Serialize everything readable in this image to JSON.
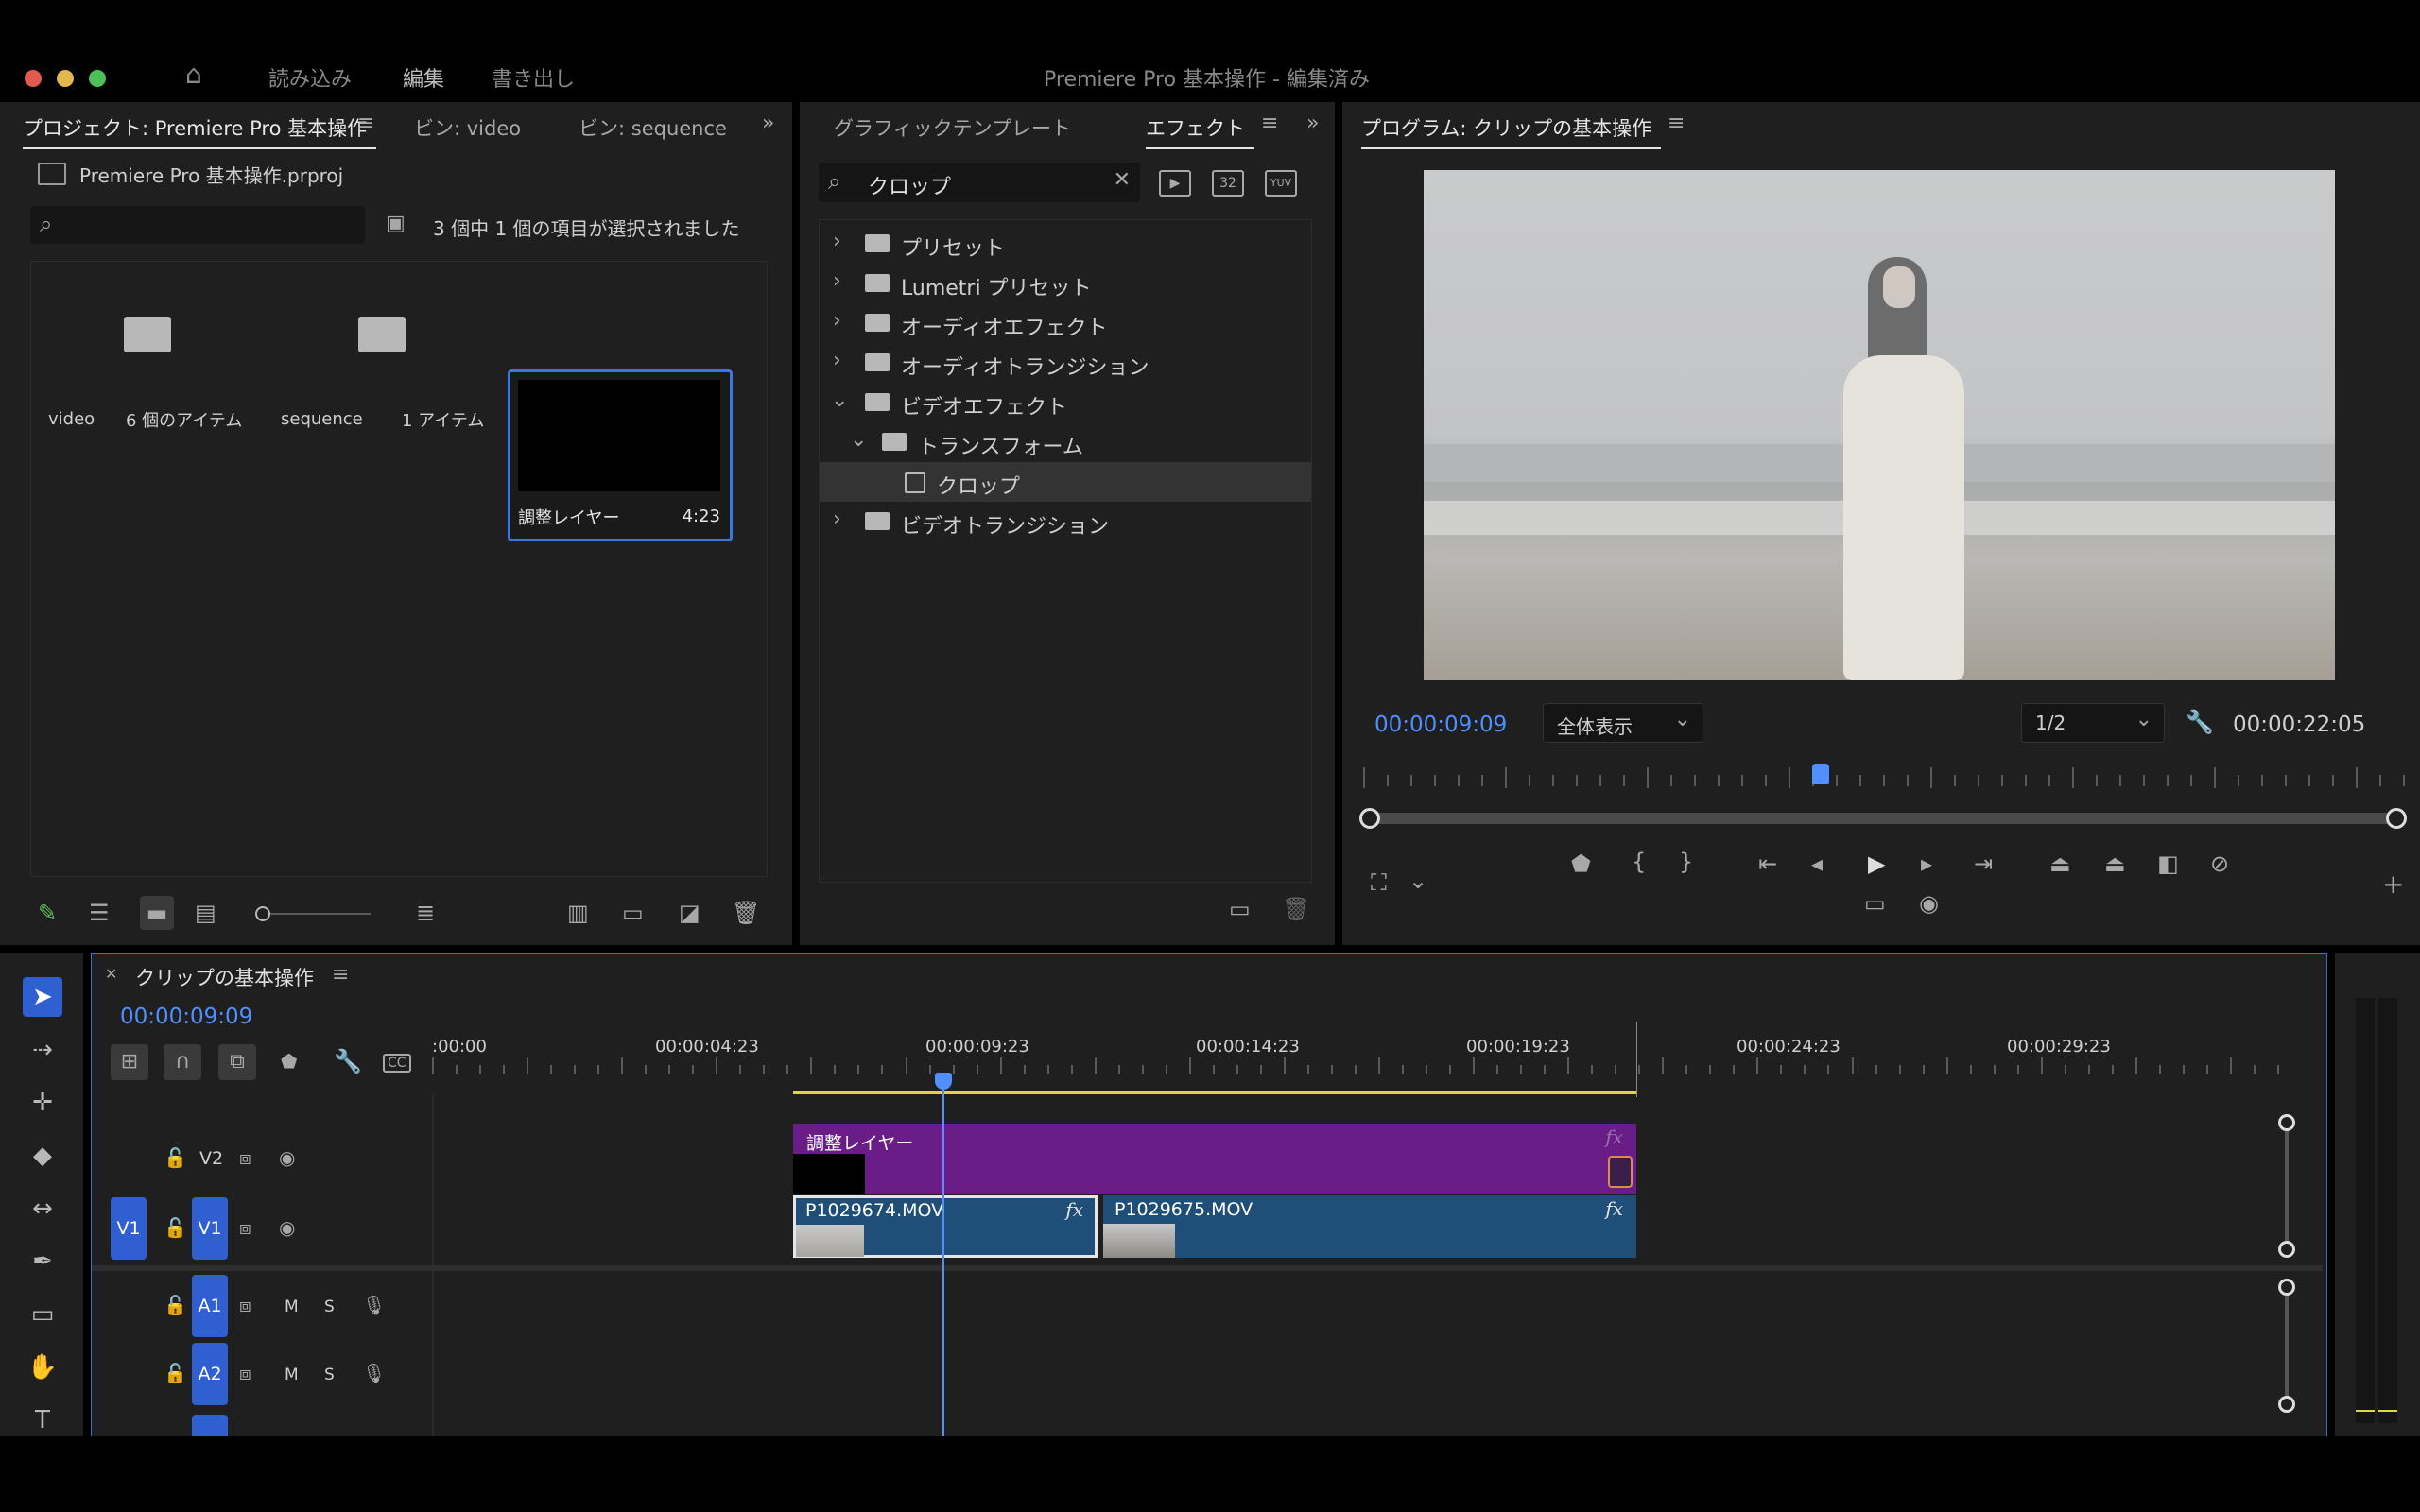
{
  "menubar": {
    "items": [
      "読み込み",
      "編集",
      "書き出し"
    ],
    "active_index": 1,
    "window_title": "Premiere Pro 基本操作 - 編集済み"
  },
  "project_panel": {
    "tabs": [
      "プロジェクト: Premiere Pro 基本操作",
      "ビン: video",
      "ビン: sequence"
    ],
    "file_name": "Premiere Pro 基本操作.prproj",
    "search_placeholder": "",
    "selection_status": "3 個中 1 個の項目が選択されました",
    "items": [
      {
        "name": "video",
        "meta": "6 個のアイテム"
      },
      {
        "name": "sequence",
        "meta": "1 アイテム"
      },
      {
        "name": "調整レイヤー",
        "meta": "4:23"
      }
    ]
  },
  "effects_panel": {
    "tabs": [
      "グラフィックテンプレート",
      "エフェクト"
    ],
    "search_value": "クロップ",
    "tree": [
      {
        "label": "プリセット",
        "level": 0,
        "expanded": false
      },
      {
        "label": "Lumetri プリセット",
        "level": 0,
        "expanded": false
      },
      {
        "label": "オーディオエフェクト",
        "level": 0,
        "expanded": false
      },
      {
        "label": "オーディオトランジション",
        "level": 0,
        "expanded": false
      },
      {
        "label": "ビデオエフェクト",
        "level": 0,
        "expanded": true
      },
      {
        "label": "トランスフォーム",
        "level": 1,
        "expanded": true
      },
      {
        "label": "クロップ",
        "level": 2,
        "selected": true
      },
      {
        "label": "ビデオトランジション",
        "level": 0,
        "expanded": false
      }
    ],
    "badge_32": "32",
    "badge_yuv": "YUV"
  },
  "program_monitor": {
    "title": "プログラム: クリップの基本操作",
    "current_time": "00:00:09:09",
    "zoom_option": "全体表示",
    "resolution_option": "1/2",
    "duration": "00:00:22:05",
    "playhead_fraction": 0.44
  },
  "timeline": {
    "sequence_name": "クリップの基本操作",
    "current_time": "00:00:09:09",
    "ruler_labels": [
      ":00:00",
      "00:00:04:23",
      "00:00:09:23",
      "00:00:14:23",
      "00:00:19:23",
      "00:00:24:23",
      "00:00:29:23"
    ],
    "tracks": {
      "v2": "V2",
      "v1_source": "V1",
      "v1": "V1",
      "a1": "A1",
      "a2": "A2",
      "mute": "M",
      "solo": "S"
    },
    "clips": {
      "adjustment_layer": "調整レイヤー",
      "clip1": "P1029674.MOV",
      "clip2": "P1029675.MOV",
      "fx": "fx"
    },
    "colors": {
      "adjustment": "#6a1d86",
      "video_clip": "#1f4f78",
      "accent": "#4f8fff"
    }
  }
}
